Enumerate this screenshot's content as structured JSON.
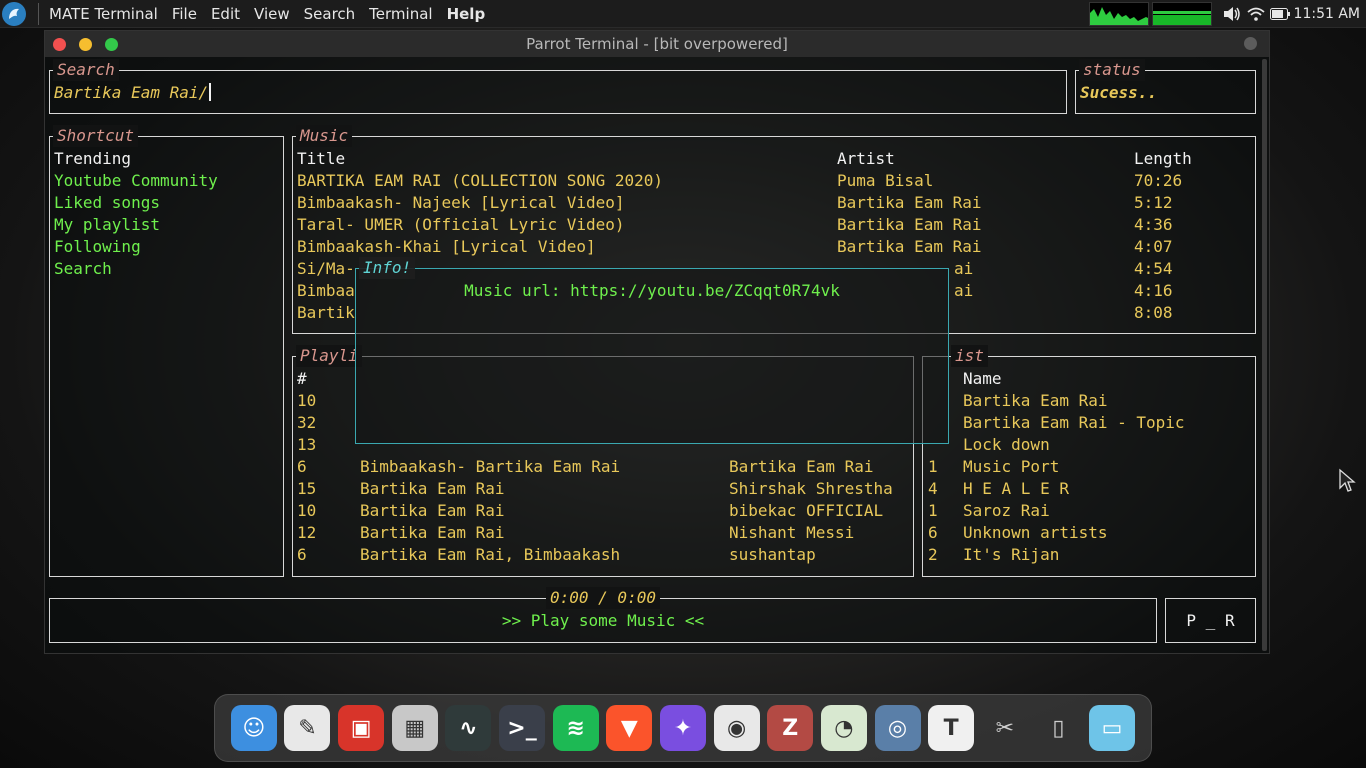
{
  "top_panel": {
    "app_name": "MATE Terminal",
    "menus": [
      "File",
      "Edit",
      "View",
      "Search",
      "Terminal",
      "Help"
    ],
    "clock": "11:51 AM"
  },
  "window": {
    "title": "Parrot Terminal - [bit overpowered]"
  },
  "search": {
    "title": "Search",
    "value": "Bartika Eam Rai/"
  },
  "status": {
    "title": "status",
    "value": "Sucess.."
  },
  "shortcut": {
    "title": "Shortcut",
    "items": [
      "Trending",
      "Youtube Community",
      "Liked songs",
      "My playlist",
      "Following",
      "Search"
    ]
  },
  "music": {
    "title": "Music",
    "headers": {
      "title": "Title",
      "artist": "Artist",
      "length": "Length"
    },
    "rows": [
      {
        "title": "BARTIKA EAM RAI (COLLECTION SONG 2020)",
        "artist": "Puma Bisal",
        "length": "70:26"
      },
      {
        "title": "Bimbaakash- Najeek [Lyrical Video]",
        "artist": "Bartika Eam Rai",
        "length": "5:12"
      },
      {
        "title": "Taral- UMER (Official Lyric Video)",
        "artist": "Bartika Eam Rai",
        "length": "4:36"
      },
      {
        "title": "Bimbaakash-Khai [Lyrical Video]",
        "artist": "Bartika Eam Rai",
        "length": "4:07"
      },
      {
        "title": "Si/Ma-",
        "artist": "ai",
        "length": "4:54"
      },
      {
        "title": "Bimbaa",
        "artist": "ai",
        "length": "4:16"
      },
      {
        "title": "Bartik",
        "artist": "",
        "length": "8:08"
      }
    ]
  },
  "info": {
    "title": "Info!",
    "text": "Music url: https://youtu.be/ZCqqt0R74vk"
  },
  "playlist": {
    "title": "Playli",
    "header_num": "#",
    "rows": [
      {
        "num": "10",
        "name": "",
        "author": ""
      },
      {
        "num": "32",
        "name": "",
        "author": ""
      },
      {
        "num": "13",
        "name": "",
        "author": ""
      },
      {
        "num": "6",
        "name": "Bimbaakash- Bartika Eam Rai",
        "author": "Bartika Eam Rai"
      },
      {
        "num": "15",
        "name": "Bartika Eam Rai",
        "author": "Shirshak Shrestha"
      },
      {
        "num": "10",
        "name": "Bartika Eam Rai",
        "author": "bibekac OFFICIAL"
      },
      {
        "num": "12",
        "name": "Bartika Eam Rai",
        "author": "Nishant Messi"
      },
      {
        "num": "6",
        "name": "Bartika Eam Rai, Bimbaakash",
        "author": "sushantap"
      }
    ]
  },
  "artist": {
    "title": "ist",
    "header_name": "Name",
    "rows": [
      {
        "num": "",
        "name": "Bartika Eam Rai"
      },
      {
        "num": "",
        "name": "Bartika Eam Rai - Topic"
      },
      {
        "num": "",
        "name": "Lock down"
      },
      {
        "num": "1",
        "name": "Music Port"
      },
      {
        "num": "4",
        "name": "H E A L E R"
      },
      {
        "num": "1",
        "name": "Saroz Rai"
      },
      {
        "num": "6",
        "name": "Unknown artists"
      },
      {
        "num": "2",
        "name": "It's Rijan"
      }
    ]
  },
  "player": {
    "time": "0:00 / 0:00",
    "message": ">> Play some Music <<",
    "controls": "P _ R"
  },
  "dock_apps": [
    {
      "name": "finder-icon",
      "glyph": "☺",
      "bg": "#3d8fe0"
    },
    {
      "name": "text-editor-icon",
      "glyph": "✎",
      "bg": "#e8e8e8"
    },
    {
      "name": "photo-viewer-icon",
      "glyph": "▣",
      "bg": "#d8342a"
    },
    {
      "name": "calculator-icon",
      "glyph": "▦",
      "bg": "#c8c8c8"
    },
    {
      "name": "system-monitor-icon",
      "glyph": "∿",
      "bg": "#2f3a3a"
    },
    {
      "name": "terminal-icon",
      "glyph": ">_",
      "bg": "#3a3f4a"
    },
    {
      "name": "spotify-icon",
      "glyph": "≋",
      "bg": "#1db954"
    },
    {
      "name": "brave-icon",
      "glyph": "▼",
      "bg": "#fb542b"
    },
    {
      "name": "compass-icon",
      "glyph": "✦",
      "bg": "#7a4ee0"
    },
    {
      "name": "chrome-icon",
      "glyph": "◉",
      "bg": "#e8e8e8"
    },
    {
      "name": "zotero-icon",
      "glyph": "Z",
      "bg": "#b34a44"
    },
    {
      "name": "disk-icon",
      "glyph": "◔",
      "bg": "#d8e8d0"
    },
    {
      "name": "screenshot-icon",
      "glyph": "◎",
      "bg": "#5a7fa8"
    },
    {
      "name": "font-viewer-icon",
      "glyph": "T",
      "bg": "#f0f0f0"
    },
    {
      "name": "scissors-icon",
      "glyph": "✂",
      "bg": "transparent"
    },
    {
      "name": "trash-icon",
      "glyph": "▯",
      "bg": "transparent"
    },
    {
      "name": "files-icon",
      "glyph": "▭",
      "bg": "#6ec4e8"
    }
  ]
}
